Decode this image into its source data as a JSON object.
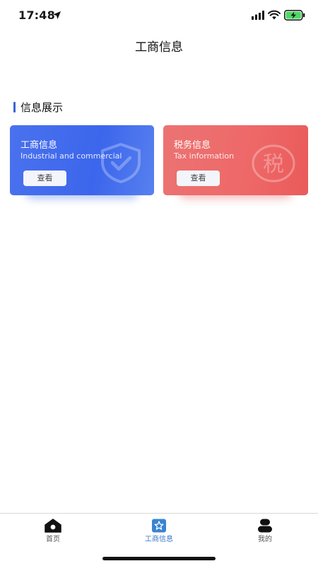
{
  "status_bar": {
    "time": "17:48"
  },
  "header": {
    "title": "工商信息"
  },
  "section": {
    "title": "信息展示"
  },
  "cards": [
    {
      "title": "工商信息",
      "subtitle": "Industrial and commercial",
      "button_label": "查看",
      "watermark": "shield-check-icon",
      "color": "#4169EC"
    },
    {
      "title": "税务信息",
      "subtitle": "Tax information",
      "button_label": "查看",
      "watermark_text": "税",
      "color": "#EC6767"
    }
  ],
  "tab_bar": {
    "tabs": [
      {
        "label": "首页",
        "icon": "home-icon",
        "active": false
      },
      {
        "label": "工商信息",
        "icon": "star-shield-icon",
        "active": true
      },
      {
        "label": "我的",
        "icon": "user-icon",
        "active": false
      }
    ],
    "active_color": "#3A76C8"
  }
}
